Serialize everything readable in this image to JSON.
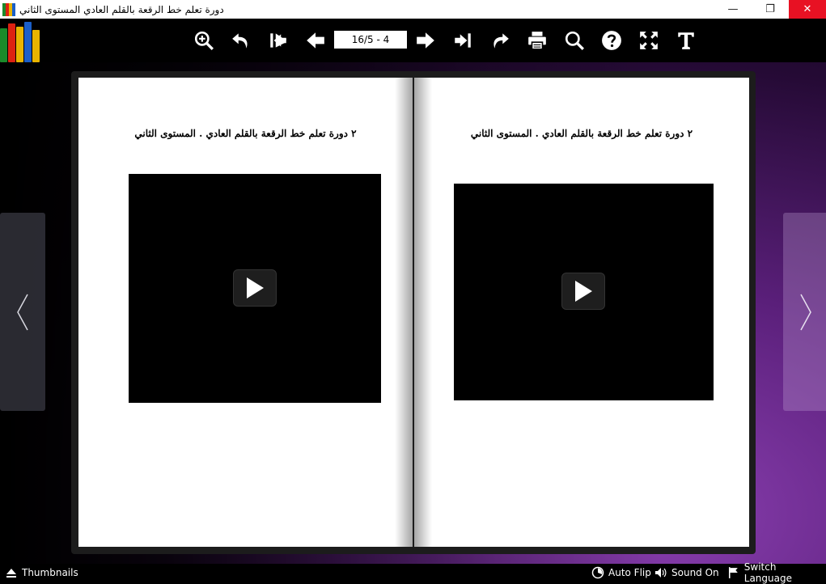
{
  "window": {
    "title": "دورة تعلم خط الرقعة بالقلم العادي المستوى الثاني",
    "controls": {
      "minimize": "—",
      "restore": "❐",
      "close": "✕"
    }
  },
  "toolbar": {
    "page_indicator": "16/5 - 4",
    "buttons": [
      "zoom-in-icon",
      "undo-icon",
      "first-page-icon",
      "previous-page-icon",
      "next-page-icon",
      "last-page-icon",
      "share-icon",
      "print-icon",
      "search-icon",
      "help-icon",
      "fullscreen-icon",
      "text-icon"
    ]
  },
  "book": {
    "left_page": {
      "heading": "٢ دورة تعلم خط الرقعة بالقلم العادي . المستوى الثاني"
    },
    "right_page": {
      "heading": "٢ دورة تعلم خط الرقعة بالقلم العادي . المستوى الثاني"
    }
  },
  "bottom_bar": {
    "thumbnails": "Thumbnails",
    "auto_flip": "Auto Flip",
    "sound": "Sound On",
    "switch_language": "Switch Language"
  },
  "colors": {
    "accent_purple": "#7a2fa0",
    "close_red": "#e81123"
  }
}
